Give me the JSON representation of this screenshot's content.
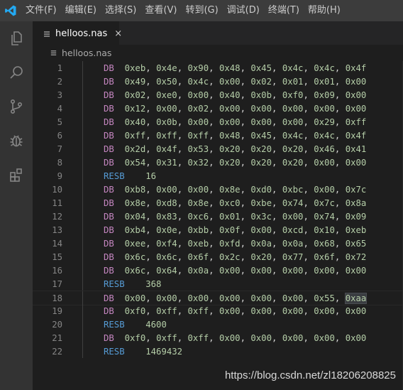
{
  "menubar": {
    "items": [
      "文件(F)",
      "编辑(E)",
      "选择(S)",
      "查看(V)",
      "转到(G)",
      "调试(D)",
      "终端(T)",
      "帮助(H)"
    ]
  },
  "activity_bar": {
    "icons": [
      "files-icon",
      "search-icon",
      "source-control-icon",
      "debug-icon",
      "extensions-icon"
    ]
  },
  "tab": {
    "label": "helloos.nas",
    "close": "×"
  },
  "breadcrumb": {
    "label": "helloos.nas"
  },
  "editor": {
    "lines": [
      {
        "n": "1",
        "op": "DB",
        "args": "0xeb, 0x4e, 0x90, 0x48, 0x45, 0x4c, 0x4c, 0x4f"
      },
      {
        "n": "2",
        "op": "DB",
        "args": "0x49, 0x50, 0x4c, 0x00, 0x02, 0x01, 0x01, 0x00"
      },
      {
        "n": "3",
        "op": "DB",
        "args": "0x02, 0xe0, 0x00, 0x40, 0x0b, 0xf0, 0x09, 0x00"
      },
      {
        "n": "4",
        "op": "DB",
        "args": "0x12, 0x00, 0x02, 0x00, 0x00, 0x00, 0x00, 0x00"
      },
      {
        "n": "5",
        "op": "DB",
        "args": "0x40, 0x0b, 0x00, 0x00, 0x00, 0x00, 0x29, 0xff"
      },
      {
        "n": "6",
        "op": "DB",
        "args": "0xff, 0xff, 0xff, 0x48, 0x45, 0x4c, 0x4c, 0x4f"
      },
      {
        "n": "7",
        "op": "DB",
        "args": "0x2d, 0x4f, 0x53, 0x20, 0x20, 0x20, 0x46, 0x41"
      },
      {
        "n": "8",
        "op": "DB",
        "args": "0x54, 0x31, 0x32, 0x20, 0x20, 0x20, 0x00, 0x00"
      },
      {
        "n": "9",
        "op": "RESB",
        "args": "16"
      },
      {
        "n": "10",
        "op": "DB",
        "args": "0xb8, 0x00, 0x00, 0x8e, 0xd0, 0xbc, 0x00, 0x7c"
      },
      {
        "n": "11",
        "op": "DB",
        "args": "0x8e, 0xd8, 0x8e, 0xc0, 0xbe, 0x74, 0x7c, 0x8a"
      },
      {
        "n": "12",
        "op": "DB",
        "args": "0x04, 0x83, 0xc6, 0x01, 0x3c, 0x00, 0x74, 0x09"
      },
      {
        "n": "13",
        "op": "DB",
        "args": "0xb4, 0x0e, 0xbb, 0x0f, 0x00, 0xcd, 0x10, 0xeb"
      },
      {
        "n": "14",
        "op": "DB",
        "args": "0xee, 0xf4, 0xeb, 0xfd, 0x0a, 0x0a, 0x68, 0x65"
      },
      {
        "n": "15",
        "op": "DB",
        "args": "0x6c, 0x6c, 0x6f, 0x2c, 0x20, 0x77, 0x6f, 0x72"
      },
      {
        "n": "16",
        "op": "DB",
        "args": "0x6c, 0x64, 0x0a, 0x00, 0x00, 0x00, 0x00, 0x00"
      },
      {
        "n": "17",
        "op": "RESB",
        "args": "368"
      },
      {
        "n": "18",
        "op": "DB",
        "args": "0x00, 0x00, 0x00, 0x00, 0x00, 0x00, 0x55, 0xaa",
        "highlight": "0xaa"
      },
      {
        "n": "19",
        "op": "DB",
        "args": "0xf0, 0xff, 0xff, 0x00, 0x00, 0x00, 0x00, 0x00"
      },
      {
        "n": "20",
        "op": "RESB",
        "args": "4600"
      },
      {
        "n": "21",
        "op": "DB",
        "args": "0xf0, 0xff, 0xff, 0x00, 0x00, 0x00, 0x00, 0x00"
      },
      {
        "n": "22",
        "op": "RESB",
        "args": "1469432"
      }
    ],
    "active_line": "18"
  },
  "watermark": "https://blog.csdn.net/zl18206208825",
  "colors": {
    "keyword_db": "#c586c0",
    "keyword_resb": "#569cd6",
    "number": "#b5cea8",
    "line_number": "#858585",
    "background": "#1e1e1e",
    "accent": "#007acc"
  }
}
